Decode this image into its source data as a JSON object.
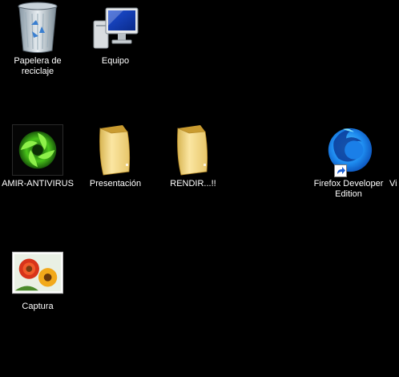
{
  "desktop": {
    "background": "#000000",
    "icons": {
      "recycle_bin": {
        "label": "Papelera de reciclaje",
        "icon": "recycle-bin-icon"
      },
      "computer": {
        "label": "Equipo",
        "icon": "computer-icon"
      },
      "antivirus": {
        "label": "AMIR-ANTIVIRUS",
        "icon": "antivirus-icon"
      },
      "presentacion": {
        "label": "Presentación",
        "icon": "folder-icon"
      },
      "rendir": {
        "label": "RENDIR...!!",
        "icon": "folder-icon"
      },
      "firefox": {
        "label": "Firefox Developer Edition",
        "icon": "firefox-developer-edition-icon"
      },
      "partial": {
        "label": "Vi",
        "icon": "truncated-icon"
      },
      "captura": {
        "label": "Captura",
        "icon": "image-file-icon"
      }
    }
  }
}
